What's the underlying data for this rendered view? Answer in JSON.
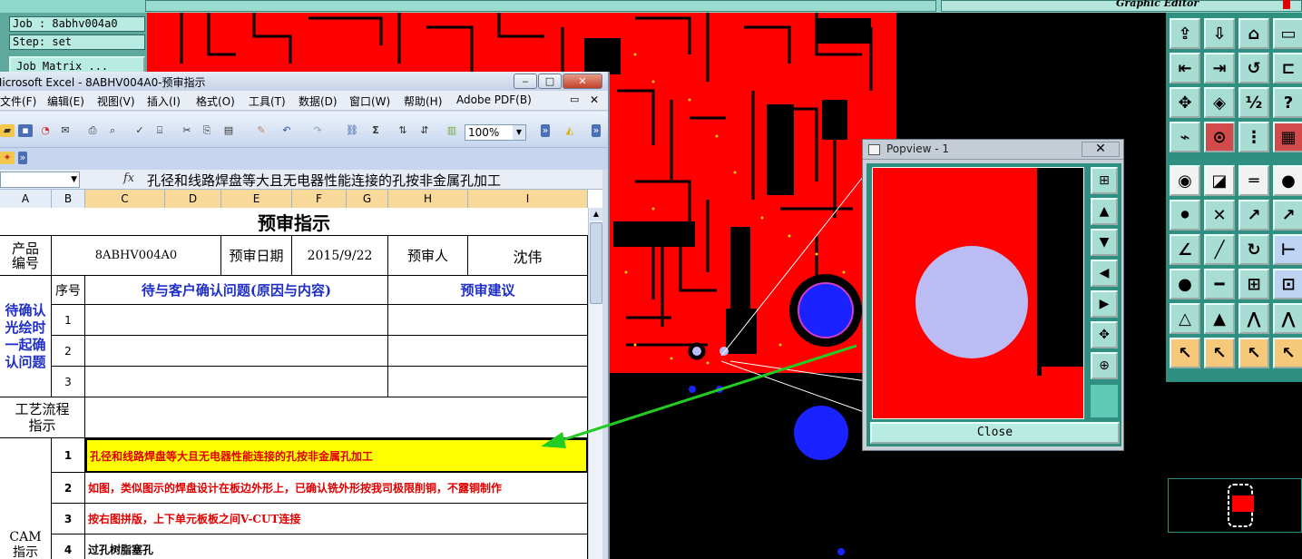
{
  "cam": {
    "editor_title": "Graphic Editor",
    "job_label": "Job : 8abhv004a0",
    "step_label": "Step: set",
    "job_matrix_button": "Job Matrix ..."
  },
  "popview": {
    "title": "Popview - 1",
    "close_x": "✕",
    "close_button": "Close"
  },
  "toolbar": {
    "icons": [
      "copy-up-icon",
      "copy-down-icon",
      "home-icon",
      "window-icon",
      "move-left-icon",
      "move-right-icon",
      "undo-icon",
      "shape-icon",
      "fit-icon",
      "center-icon",
      "scale-icon",
      "help-icon",
      "probe-icon",
      "measure-icon",
      "layers-icon",
      "grid-icon",
      "pad-icon",
      "line-icon",
      "ruler-icon",
      "dot-icon",
      "connect-icon",
      "cross-icon",
      "route-icon",
      "point-icon",
      "angle-icon",
      "slash-icon",
      "rotate-icon",
      "snap-icon",
      "node-icon",
      "dash-icon",
      "array-icon",
      "blocks-icon",
      "triangle-icon",
      "triangle-arrow-icon",
      "arch-icon",
      "arch2-icon",
      "pointer-icon",
      "pointer-box-icon",
      "pointer-dia-icon",
      "pointer-multi-icon"
    ]
  },
  "excel": {
    "title": "Microsoft Excel - 8ABHV004A0-预审指示",
    "window_buttons": {
      "minimize": "‒",
      "maximize": "□",
      "close": "✕"
    },
    "menu": [
      "文件(F)",
      "编辑(E)",
      "视图(V)",
      "插入(I)",
      "格式(O)",
      "工具(T)",
      "数据(D)",
      "窗口(W)",
      "帮助(H)",
      "Adobe PDF(B)"
    ],
    "menu_close": "✕",
    "zoom": "100%",
    "name_box": "",
    "fx": "fx",
    "formula": "孔径和线路焊盘等大且无电器性能连接的孔按非金属孔加工",
    "columns": [
      "A",
      "B",
      "C",
      "D",
      "E",
      "F",
      "G",
      "H",
      "I"
    ],
    "sheet": {
      "title": "预审指示",
      "product_no_label": "产品\n编号",
      "product_no": "8ABHV004A0",
      "review_date_label": "预审日期",
      "review_date": "2015/9/22",
      "reviewer_label": "预审人",
      "reviewer": "沈伟",
      "seq_header": "序号",
      "issue_header": "待与客户确认问题(原因与内容)",
      "suggestion_header": "预审建议",
      "confirm_label": "待确认\n光绘时\n一起确\n认问题",
      "confirm_rows": [
        "1",
        "2",
        "3"
      ],
      "process_label": "工艺流程\n指示",
      "cam_label": "CAM\n指示",
      "cam_rows": [
        {
          "no": "1",
          "text": "孔径和线路焊盘等大且无电器性能连接的孔按非金属孔加工"
        },
        {
          "no": "2",
          "text": "如图，类似图示的焊盘设计在板边外形上，已确认铣外形按我司极限削铜，不露铜制作"
        },
        {
          "no": "3",
          "text": "按右图拼版，上下单元板板之间V-CUT连接"
        },
        {
          "no": "4",
          "text": "过孔树脂塞孔"
        }
      ]
    }
  },
  "colors": {
    "pcb_red": "#ff0000",
    "pad_blue": "#1a22ff",
    "pad_lavender": "#bcbcf5",
    "highlight_yellow": "#ffff00",
    "arrow_green": "#22cc22",
    "panel_teal": "#2f8f80"
  }
}
